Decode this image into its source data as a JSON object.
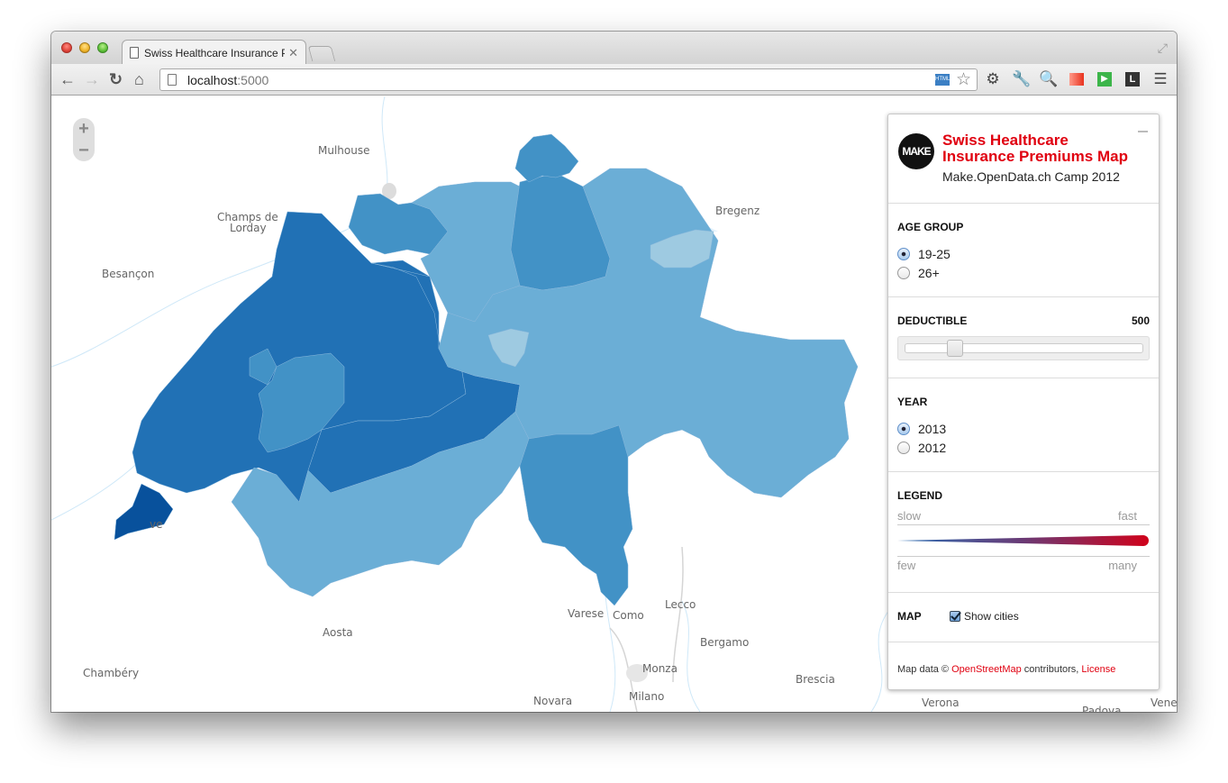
{
  "browser": {
    "tab_title": "Swiss Healthcare Insurance P",
    "url_host": "localhost",
    "url_port": ":5000",
    "extensions": [
      "gear-icon",
      "wrench-icon",
      "database-search-icon",
      "red-book-icon",
      "green-play-icon",
      "L-logo-icon",
      "menu-icon"
    ]
  },
  "map": {
    "zoom_in": "+",
    "zoom_out": "−",
    "cities": [
      {
        "name": "Mulhouse"
      },
      {
        "name": "Champs de"
      },
      {
        "name": "Lorday"
      },
      {
        "name": "Besançon"
      },
      {
        "name": "Bregenz"
      },
      {
        "name": "Aosta"
      },
      {
        "name": "Chambéry"
      },
      {
        "name": "Varese"
      },
      {
        "name": "Como"
      },
      {
        "name": "Lecco"
      },
      {
        "name": "Bergamo"
      },
      {
        "name": "Monza"
      },
      {
        "name": "Milano"
      },
      {
        "name": "Novara"
      },
      {
        "name": "Brescia"
      },
      {
        "name": "Verona"
      },
      {
        "name": "Padova"
      },
      {
        "name": "Venezia"
      },
      {
        "name": "ve"
      }
    ],
    "colors": {
      "darkest": "#08519c",
      "dark": "#2171b5",
      "medium": "#4292c6",
      "light": "#6baed6",
      "lightest": "#9ecae1",
      "water": "#e3f2fc"
    }
  },
  "panel": {
    "logo": "MAKE",
    "title_line1": "Swiss Healthcare",
    "title_line2": "Insurance Premiums Map",
    "subtitle": "Make.OpenData.ch Camp 2012",
    "age_group": {
      "label": "AGE GROUP",
      "options": [
        {
          "label": "19-25",
          "selected": true
        },
        {
          "label": "26+",
          "selected": false
        }
      ]
    },
    "deductible": {
      "label": "DEDUCTIBLE",
      "value": "500",
      "slider_fraction": 0.2
    },
    "year": {
      "label": "YEAR",
      "options": [
        {
          "label": "2013",
          "selected": true
        },
        {
          "label": "2012",
          "selected": false
        }
      ]
    },
    "legend": {
      "label": "LEGEND",
      "top_left": "slow",
      "top_right": "fast",
      "bottom_left": "few",
      "bottom_right": "many",
      "gradient_start": "#2a6fb5",
      "gradient_end": "#d0021b"
    },
    "map_section": {
      "label": "MAP",
      "show_cities_label": "Show cities",
      "show_cities_checked": true
    },
    "attribution": {
      "prefix": "Map data © ",
      "osm_link": "OpenStreetMap",
      "middle": " contributors, ",
      "license_link": "License"
    }
  }
}
